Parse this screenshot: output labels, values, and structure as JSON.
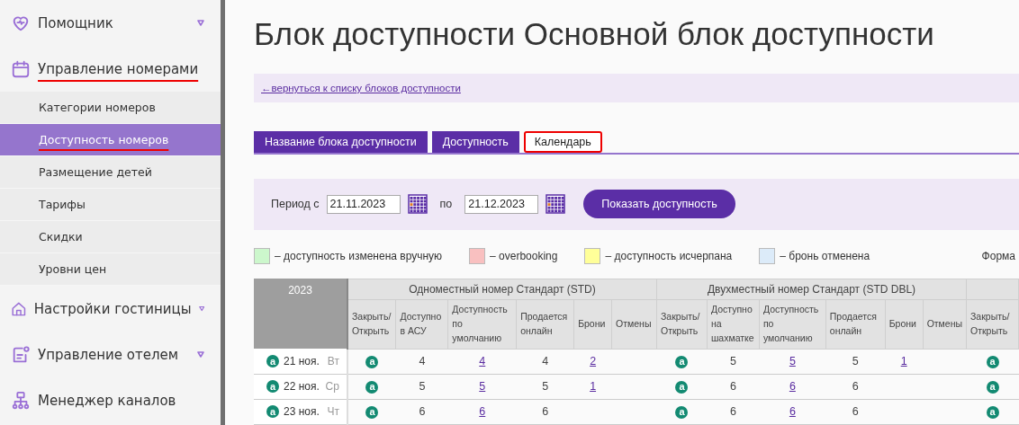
{
  "sidebar": {
    "items": [
      {
        "label": "Помощник",
        "expanded": false,
        "highlighted": false
      },
      {
        "label": "Управление номерами",
        "expanded": true,
        "highlighted": true,
        "children": [
          {
            "label": "Категории номеров",
            "selected": false,
            "highlighted": false
          },
          {
            "label": "Доступность номеров",
            "selected": true,
            "highlighted": true
          },
          {
            "label": "Размещение детей",
            "selected": false,
            "highlighted": false
          },
          {
            "label": "Тарифы",
            "selected": false,
            "highlighted": false
          },
          {
            "label": "Скидки",
            "selected": false,
            "highlighted": false
          },
          {
            "label": "Уровни цен",
            "selected": false,
            "highlighted": false
          }
        ]
      },
      {
        "label": "Настройки гостиницы",
        "expanded": false,
        "highlighted": false
      },
      {
        "label": "Управление отелем",
        "expanded": false,
        "highlighted": false
      },
      {
        "label": "Менеджер каналов",
        "highlighted": false
      }
    ]
  },
  "page_title": "Блок доступности Основной блок доступности",
  "back_link": "←вернуться к списку блоков доступности",
  "tabs": [
    {
      "label": "Название блока доступности",
      "selected": false,
      "highlighted": false
    },
    {
      "label": "Доступность",
      "selected": false,
      "highlighted": false
    },
    {
      "label": "Календарь",
      "selected": true,
      "highlighted": true
    }
  ],
  "filter": {
    "period_label": "Период с",
    "from": "21.11.2023",
    "to_label": "по",
    "to": "21.12.2023",
    "button": "Показать доступность"
  },
  "legend": {
    "items": [
      {
        "label": "– доступность изменена вручную",
        "color": "#ccf7cc"
      },
      {
        "label": "– overbooking",
        "color": "#f9c0c0"
      },
      {
        "label": "– доступность исчерпана",
        "color": "#ffff99"
      },
      {
        "label": "– бронь отменена",
        "color": "#dcebf9"
      }
    ],
    "format_label": "Форма"
  },
  "table": {
    "year": "2023",
    "groups": [
      {
        "title": "Одноместный номер Стандарт (STD)",
        "columns": [
          "Закрыть/ Открыть",
          "Доступно в АСУ",
          "Доступность по умолчанию",
          "Продается онлайн",
          "Брони",
          "Отмены"
        ]
      },
      {
        "title": "Двухместный номер Стандарт (STD DBL)",
        "columns": [
          "Закрыть/ Открыть",
          "Доступно на шахматке",
          "Доступность по умолчанию",
          "Продается онлайн",
          "Брони",
          "Отмены"
        ]
      },
      {
        "columns": [
          "Закрыть/ Открыть"
        ]
      }
    ],
    "rows": [
      {
        "badge": "a",
        "date": "21 ноя.",
        "weekday": "Вт",
        "cells": [
          {
            "kind": "badge",
            "text": "a"
          },
          {
            "kind": "plain",
            "text": "4"
          },
          {
            "kind": "link",
            "text": "4"
          },
          {
            "kind": "plain",
            "text": "4"
          },
          {
            "kind": "link",
            "text": "2"
          },
          {
            "kind": "empty"
          },
          {
            "kind": "badge",
            "text": "a"
          },
          {
            "kind": "plain",
            "text": "5"
          },
          {
            "kind": "link",
            "text": "5"
          },
          {
            "kind": "plain",
            "text": "5"
          },
          {
            "kind": "link",
            "text": "1"
          },
          {
            "kind": "empty"
          },
          {
            "kind": "badge",
            "text": "a"
          }
        ]
      },
      {
        "badge": "a",
        "date": "22 ноя.",
        "weekday": "Ср",
        "cells": [
          {
            "kind": "badge",
            "text": "a"
          },
          {
            "kind": "plain",
            "text": "5"
          },
          {
            "kind": "link",
            "text": "5"
          },
          {
            "kind": "plain",
            "text": "5"
          },
          {
            "kind": "link",
            "text": "1"
          },
          {
            "kind": "empty"
          },
          {
            "kind": "badge",
            "text": "a"
          },
          {
            "kind": "plain",
            "text": "6"
          },
          {
            "kind": "link",
            "text": "6"
          },
          {
            "kind": "plain",
            "text": "6"
          },
          {
            "kind": "empty"
          },
          {
            "kind": "empty"
          },
          {
            "kind": "badge",
            "text": "a"
          }
        ]
      },
      {
        "badge": "a",
        "date": "23 ноя.",
        "weekday": "Чт",
        "cells": [
          {
            "kind": "badge",
            "text": "a"
          },
          {
            "kind": "plain",
            "text": "6"
          },
          {
            "kind": "link",
            "text": "6"
          },
          {
            "kind": "plain",
            "text": "6"
          },
          {
            "kind": "empty"
          },
          {
            "kind": "empty"
          },
          {
            "kind": "badge",
            "text": "a"
          },
          {
            "kind": "plain",
            "text": "6"
          },
          {
            "kind": "link",
            "text": "6"
          },
          {
            "kind": "plain",
            "text": "6"
          },
          {
            "kind": "empty"
          },
          {
            "kind": "empty"
          },
          {
            "kind": "badge",
            "text": "a"
          }
        ]
      }
    ]
  }
}
